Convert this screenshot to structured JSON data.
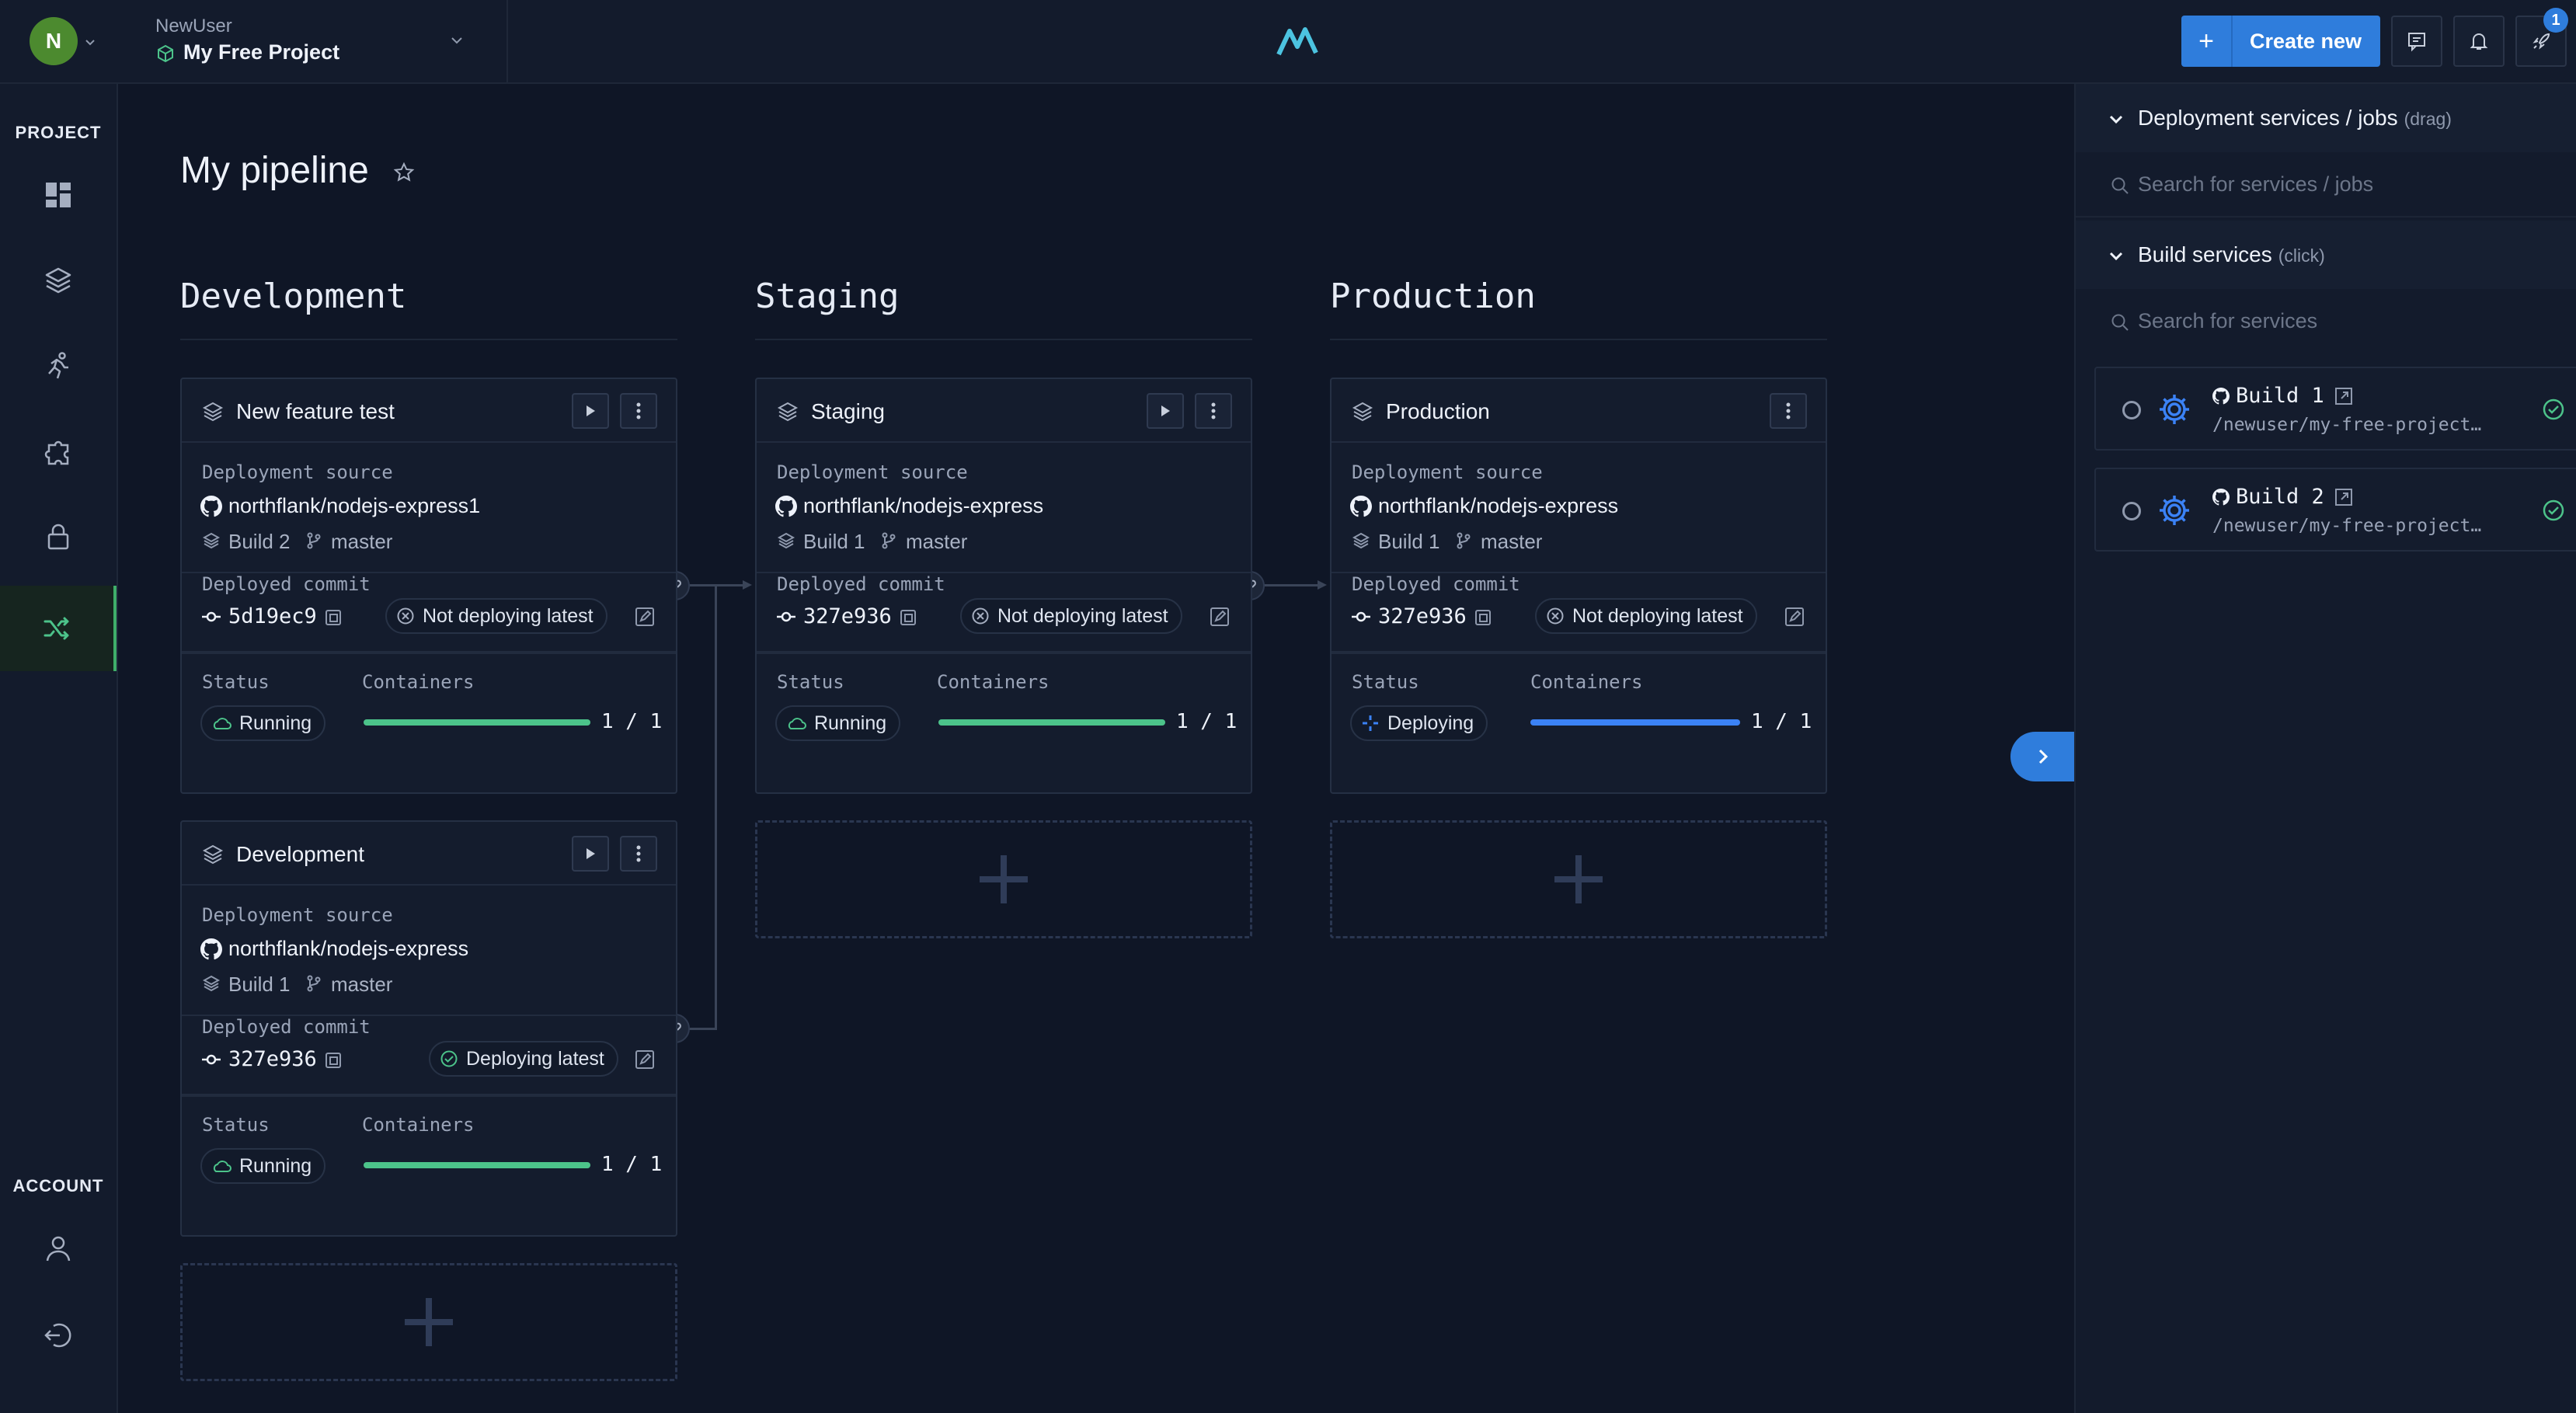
{
  "topbar": {
    "avatar_letter": "N",
    "user_name": "NewUser",
    "project_name": "My Free Project",
    "create_label": "Create new",
    "notification_count": "1"
  },
  "sidebar": {
    "project_heading": "PROJECT",
    "account_heading": "ACCOUNT",
    "items": [
      {
        "icon": "dashboard-icon"
      },
      {
        "icon": "layers-icon"
      },
      {
        "icon": "runner-icon"
      },
      {
        "icon": "puzzle-icon"
      },
      {
        "icon": "lock-icon"
      },
      {
        "icon": "pipeline-shuffle-icon",
        "active": true
      }
    ]
  },
  "main": {
    "title": "My pipeline",
    "stages": [
      {
        "heading": "Development"
      },
      {
        "heading": "Staging"
      },
      {
        "heading": "Production"
      }
    ],
    "cards": [
      {
        "title": "New feature test",
        "source_label": "Deployment source",
        "repo": "northflank/nodejs-express1",
        "build": "Build 2",
        "branch": "master",
        "commit_label": "Deployed commit",
        "commit": "5d19ec9",
        "deploy_status": "Not deploying latest",
        "status_label": "Status",
        "containers_label": "Containers",
        "status": "Running",
        "containers": "1 / 1",
        "containers_fraction": 1.0
      },
      {
        "title": "Development",
        "source_label": "Deployment source",
        "repo": "northflank/nodejs-express",
        "build": "Build 1",
        "branch": "master",
        "commit_label": "Deployed commit",
        "commit": "327e936",
        "deploy_status": "Deploying latest",
        "status_label": "Status",
        "containers_label": "Containers",
        "status": "Running",
        "containers": "1 / 1",
        "containers_fraction": 1.0
      },
      {
        "title": "Staging",
        "source_label": "Deployment source",
        "repo": "northflank/nodejs-express",
        "build": "Build 1",
        "branch": "master",
        "commit_label": "Deployed commit",
        "commit": "327e936",
        "deploy_status": "Not deploying latest",
        "status_label": "Status",
        "containers_label": "Containers",
        "status": "Running",
        "containers": "1 / 1",
        "containers_fraction": 1.0
      },
      {
        "title": "Production",
        "source_label": "Deployment source",
        "repo": "northflank/nodejs-express",
        "build": "Build 1",
        "branch": "master",
        "commit_label": "Deployed commit",
        "commit": "327e936",
        "deploy_status": "Not deploying latest",
        "status_label": "Status",
        "containers_label": "Containers",
        "status": "Deploying",
        "containers": "1 / 1",
        "containers_fraction": 1.0
      }
    ]
  },
  "right_panel": {
    "deploy_section": {
      "title": "Deployment services / jobs",
      "hint": "(drag)",
      "search_placeholder": "Search for services / jobs"
    },
    "build_section": {
      "title": "Build services",
      "hint": "(click)",
      "search_placeholder": "Search for services"
    },
    "build_services": [
      {
        "name": "Build 1",
        "path": "/newuser/my-free-project…"
      },
      {
        "name": "Build 2",
        "path": "/newuser/my-free-project…"
      }
    ]
  },
  "colors": {
    "background": "#0f1626",
    "accent_blue": "#2f7ddc",
    "running_green": "#3fae6a",
    "deploying_blue": "#3b82f6"
  }
}
